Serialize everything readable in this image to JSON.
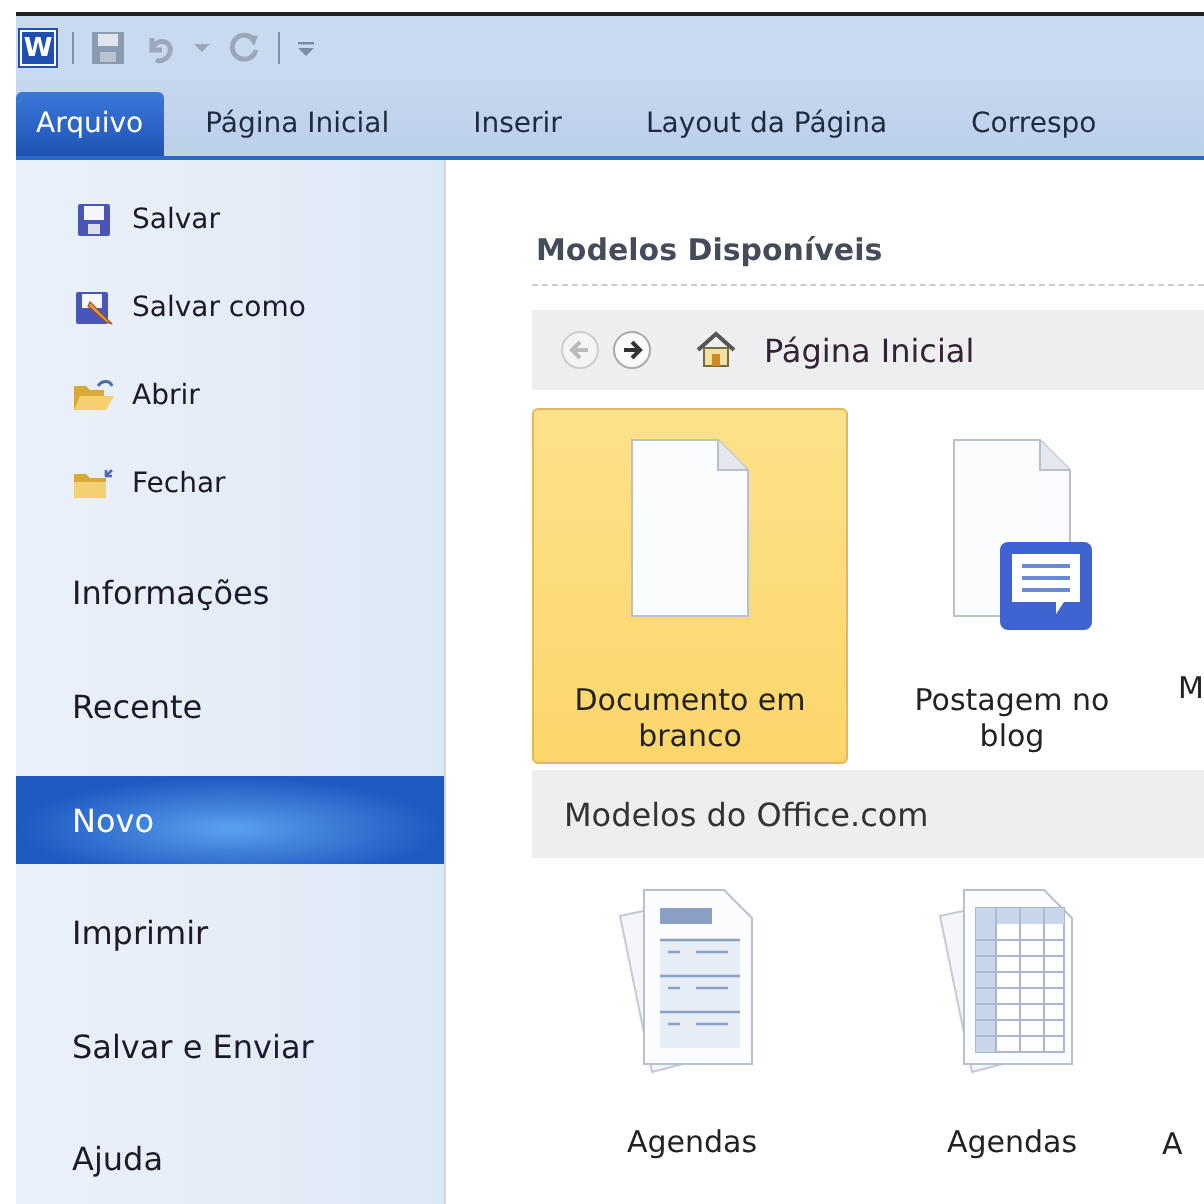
{
  "quick_access": {
    "app_icon": "W"
  },
  "tabs": [
    {
      "label": "Arquivo",
      "selected": true
    },
    {
      "label": "Página Inicial",
      "selected": false
    },
    {
      "label": "Inserir",
      "selected": false
    },
    {
      "label": "Layout da Página",
      "selected": false
    },
    {
      "label": "Correspo",
      "selected": false
    }
  ],
  "sidebar": {
    "items": [
      {
        "kind": "save",
        "label": "Salvar",
        "selected": false
      },
      {
        "kind": "saveas",
        "label": "Salvar como",
        "selected": false
      },
      {
        "kind": "open",
        "label": "Abrir",
        "selected": false
      },
      {
        "kind": "close",
        "label": "Fechar",
        "selected": false
      },
      {
        "kind": "section",
        "label": "Informações",
        "selected": false
      },
      {
        "kind": "section",
        "label": "Recente",
        "selected": false
      },
      {
        "kind": "section",
        "label": "Novo",
        "selected": true
      },
      {
        "kind": "section",
        "label": "Imprimir",
        "selected": false
      },
      {
        "kind": "section",
        "label": "Salvar e Enviar",
        "selected": false
      },
      {
        "kind": "section",
        "label": "Ajuda",
        "selected": false
      }
    ]
  },
  "content": {
    "title": "Modelos Disponíveis",
    "nav": {
      "location": "Página Inicial"
    },
    "templates": [
      {
        "kind": "blank",
        "label": "Documento em branco",
        "selected": true
      },
      {
        "kind": "blog",
        "label": "Postagem no blog",
        "selected": false
      },
      {
        "kind": "cut",
        "label": "M"
      }
    ],
    "office_header": "Modelos do Office.com",
    "office_templates": [
      {
        "kind": "form",
        "label": "Agendas"
      },
      {
        "kind": "table",
        "label": "Agendas"
      },
      {
        "kind": "cut",
        "label": "A"
      }
    ]
  }
}
